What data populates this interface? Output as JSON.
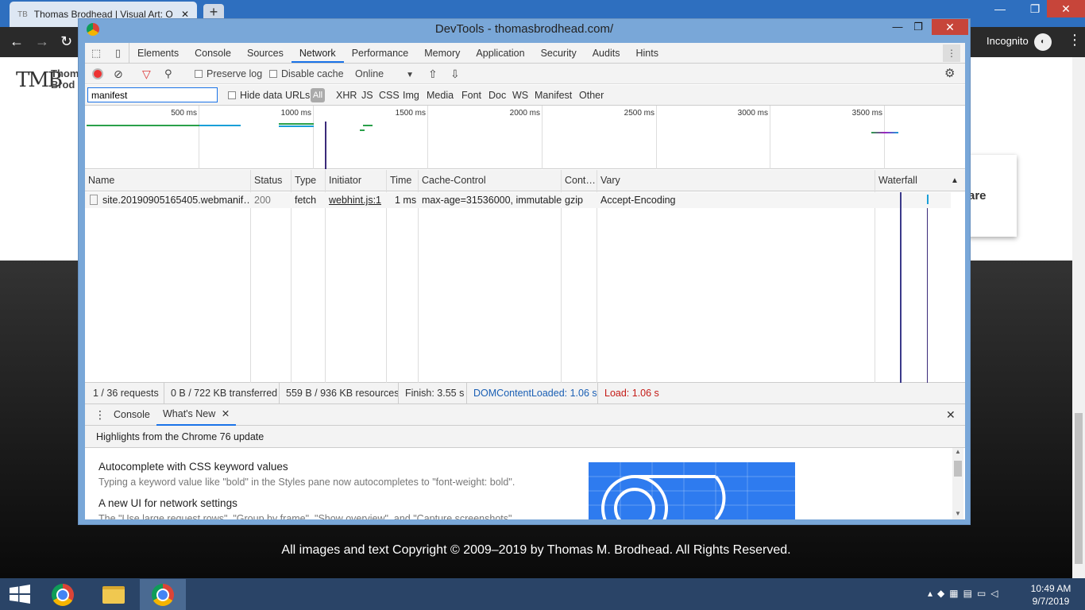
{
  "browser": {
    "tab_title": "Thomas Brodhead | Visual Art: O",
    "tab_close": "✕",
    "new_tab": "+",
    "incognito_label": "Incognito",
    "win_min": "—",
    "win_restore": "❐",
    "win_close": "✕"
  },
  "page": {
    "logo_mark": "TMB",
    "logo_line1": "Thom",
    "logo_line2": "Brod",
    "card_text": "are",
    "copyright": "All images and text Copyright © 2009–2019 by Thomas M. Brodhead. All Rights Reserved."
  },
  "devtools": {
    "title": "DevTools - thomasbrodhead.com/",
    "min": "—",
    "restore": "❐",
    "close": "✕",
    "tabs": [
      "Elements",
      "Console",
      "Sources",
      "Network",
      "Performance",
      "Memory",
      "Application",
      "Security",
      "Audits",
      "Hints"
    ],
    "selected_tab": "Network",
    "toolbar": {
      "preserve_log": "Preserve log",
      "disable_cache": "Disable cache",
      "throttle": "Online"
    },
    "filter": {
      "value": "manifest",
      "hide_data_urls": "Hide data URLs",
      "types": [
        "All",
        "XHR",
        "JS",
        "CSS",
        "Img",
        "Media",
        "Font",
        "Doc",
        "WS",
        "Manifest",
        "Other"
      ]
    },
    "overview_ticks": [
      "500 ms",
      "1000 ms",
      "1500 ms",
      "2000 ms",
      "2500 ms",
      "3000 ms",
      "3500 ms"
    ],
    "columns": [
      "Name",
      "Status",
      "Type",
      "Initiator",
      "Time",
      "Cache-Control",
      "Cont…",
      "Vary",
      "Waterfall"
    ],
    "rows": [
      {
        "name": "site.20190905165405.webmanif…",
        "status": "200",
        "type": "fetch",
        "initiator": "webhint.js:1",
        "time": "1 ms",
        "cache_control": "max-age=31536000, immutable",
        "content_encoding": "gzip",
        "vary": "Accept-Encoding"
      }
    ],
    "summary": {
      "requests": "1 / 36 requests",
      "transferred": "0 B / 722 KB transferred",
      "resources": "559 B / 936 KB resources",
      "finish": "Finish: 3.55 s",
      "dcl": "DOMContentLoaded: 1.06 s",
      "load": "Load: 1.06 s"
    },
    "drawer": {
      "tabs": [
        "Console",
        "What's New"
      ],
      "selected": "What's New",
      "header": "Highlights from the Chrome 76 update",
      "items": [
        {
          "title": "Autocomplete with CSS keyword values",
          "desc": "Typing a keyword value like \"bold\" in the Styles pane now autocompletes to \"font-weight: bold\"."
        },
        {
          "title": "A new UI for network settings",
          "desc": "The \"Use large request rows\", \"Group by frame\", \"Show overview\", and \"Capture screenshots\""
        }
      ]
    }
  },
  "taskbar": {
    "time": "10:49 AM",
    "date": "9/7/2019"
  }
}
